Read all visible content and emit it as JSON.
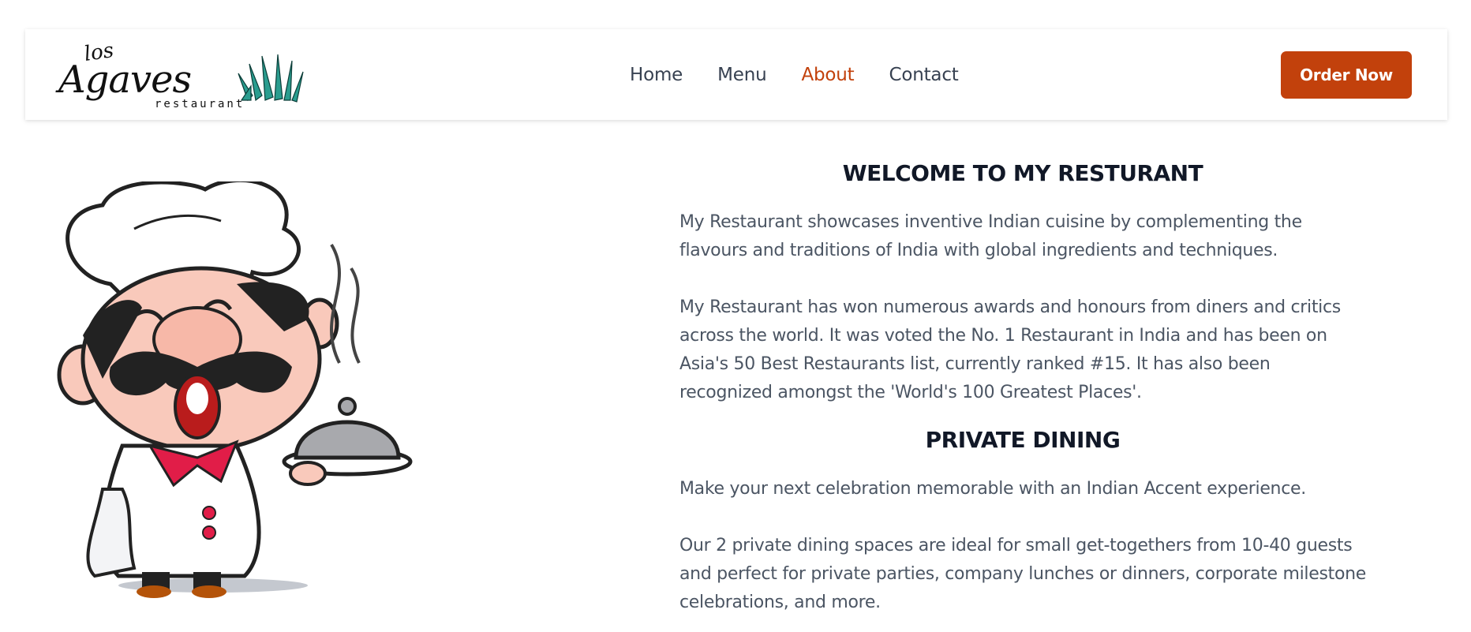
{
  "brand": {
    "logo_top": "los",
    "logo_main": "Agaves",
    "logo_sub": "restaurant",
    "accent_color": "#c2410c",
    "logo_grass_color": "#2a9d8f"
  },
  "nav": {
    "items": [
      {
        "label": "Home",
        "active": false
      },
      {
        "label": "Menu",
        "active": false
      },
      {
        "label": "About",
        "active": true
      },
      {
        "label": "Contact",
        "active": false
      }
    ],
    "cta_label": "Order Now"
  },
  "hero_image": {
    "icon": "chef-mascot-illustration"
  },
  "about": {
    "welcome_title": "WELCOME TO MY RESTURANT",
    "welcome_paragraphs": [
      "My Restaurant showcases inventive Indian cuisine by complementing the flavours and traditions of India with global ingredients and techniques.",
      "My Restaurant has won numerous awards and honours from diners and critics across the world. It was voted the No. 1 Restaurant in India and has been on Asia's 50 Best Restaurants list, currently ranked #15. It has also been recognized amongst the 'World's 100 Greatest Places'."
    ],
    "private_title": "PRIVATE DINING",
    "private_paragraphs": [
      "Make your next celebration memorable with an Indian Accent experience.",
      "Our 2 private dining spaces are ideal for small get-togethers from 10-40 guests and perfect for private parties, company lunches or dinners, corporate milestone celebrations, and more."
    ]
  }
}
